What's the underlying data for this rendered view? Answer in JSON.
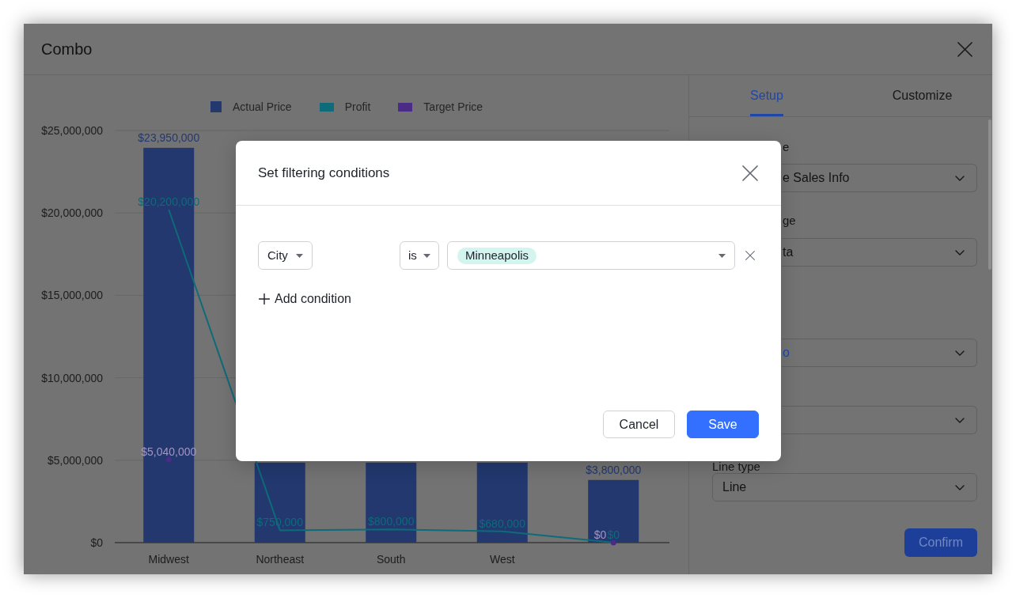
{
  "window": {
    "title": "Combo"
  },
  "chart": {
    "chart_data": {
      "type": "bar",
      "legend": "top",
      "grid": true,
      "categories": [
        "Midwest",
        "Northeast",
        "South",
        "West",
        null
      ],
      "series": [
        {
          "name": "Actual Price",
          "color": "#22386f",
          "values": [
            23950000,
            4850000,
            4850000,
            4850000,
            3800000
          ],
          "value_labels": [
            "$23,950,000",
            null,
            null,
            null,
            "$3,800,000"
          ]
        },
        {
          "name": "Profit",
          "type": "line",
          "color": "#0d6b7a",
          "values": [
            20200000,
            750000,
            800000,
            680000,
            0
          ],
          "value_labels": [
            "$20,200,000",
            "$750,000",
            "$800,000",
            "$680,000",
            "$0"
          ]
        },
        {
          "name": "Target Price",
          "type": "scatter",
          "color": "#4a2b86",
          "values": [
            5040000,
            null,
            null,
            null,
            0
          ],
          "value_labels": [
            "$5,040,000",
            null,
            null,
            null,
            "$0"
          ]
        }
      ],
      "ylim": [
        0,
        25000000
      ],
      "yticks": [
        {
          "value": 0,
          "label": "$0"
        },
        {
          "value": 5000000,
          "label": "$5,000,000"
        },
        {
          "value": 10000000,
          "label": "$10,000,000"
        },
        {
          "value": 15000000,
          "label": "$15,000,000"
        },
        {
          "value": 20000000,
          "label": "$20,000,000"
        },
        {
          "value": 25000000,
          "label": "$25,000,000"
        }
      ],
      "data_labels": true
    }
  },
  "side_panel": {
    "tabs": [
      {
        "label": "Setup",
        "selected": true
      },
      {
        "label": "Customize",
        "selected": false
      }
    ],
    "fields": [
      {
        "label": "e",
        "value": "e Sales Info",
        "covered": true,
        "highlighted": false
      },
      {
        "label": "ge",
        "value": "ta",
        "covered": true,
        "highlighted": false
      },
      {
        "value": "o",
        "covered": true,
        "highlighted": true
      },
      {
        "covered": true,
        "highlighted": false
      },
      {
        "label": "Line type",
        "value": "Line",
        "covered": false,
        "highlighted": false
      }
    ],
    "confirm_button": "Confirm"
  },
  "dialog": {
    "title": "Set filtering conditions",
    "conditions": [
      {
        "field": "City",
        "operator": "is",
        "values": [
          "Minneapolis"
        ]
      }
    ],
    "add_condition": "Add condition",
    "buttons": [
      {
        "label": "Cancel",
        "kind": "secondary"
      },
      {
        "label": "Save",
        "kind": "primary"
      }
    ]
  }
}
